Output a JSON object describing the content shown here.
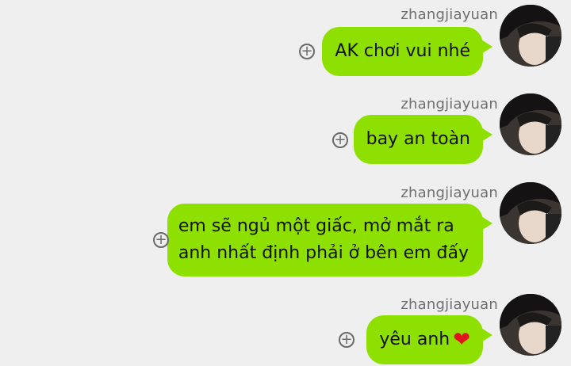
{
  "messages": [
    {
      "sender": "zhangjiayuan",
      "text": "AK chơi vui nhé"
    },
    {
      "sender": "zhangjiayuan",
      "text": "bay an toàn"
    },
    {
      "sender": "zhangjiayuan",
      "line1": "em sẽ ngủ một giấc, mở mắt ra",
      "line2": "anh nhất định phải ở bên em đấy"
    },
    {
      "sender": "zhangjiayuan",
      "text": "yêu anh",
      "emoji": "❤"
    }
  ],
  "colors": {
    "bubble": "#8ee000",
    "background": "#efefef",
    "heart": "#e1141e"
  },
  "icons": {
    "add": "plus-circle-icon"
  }
}
